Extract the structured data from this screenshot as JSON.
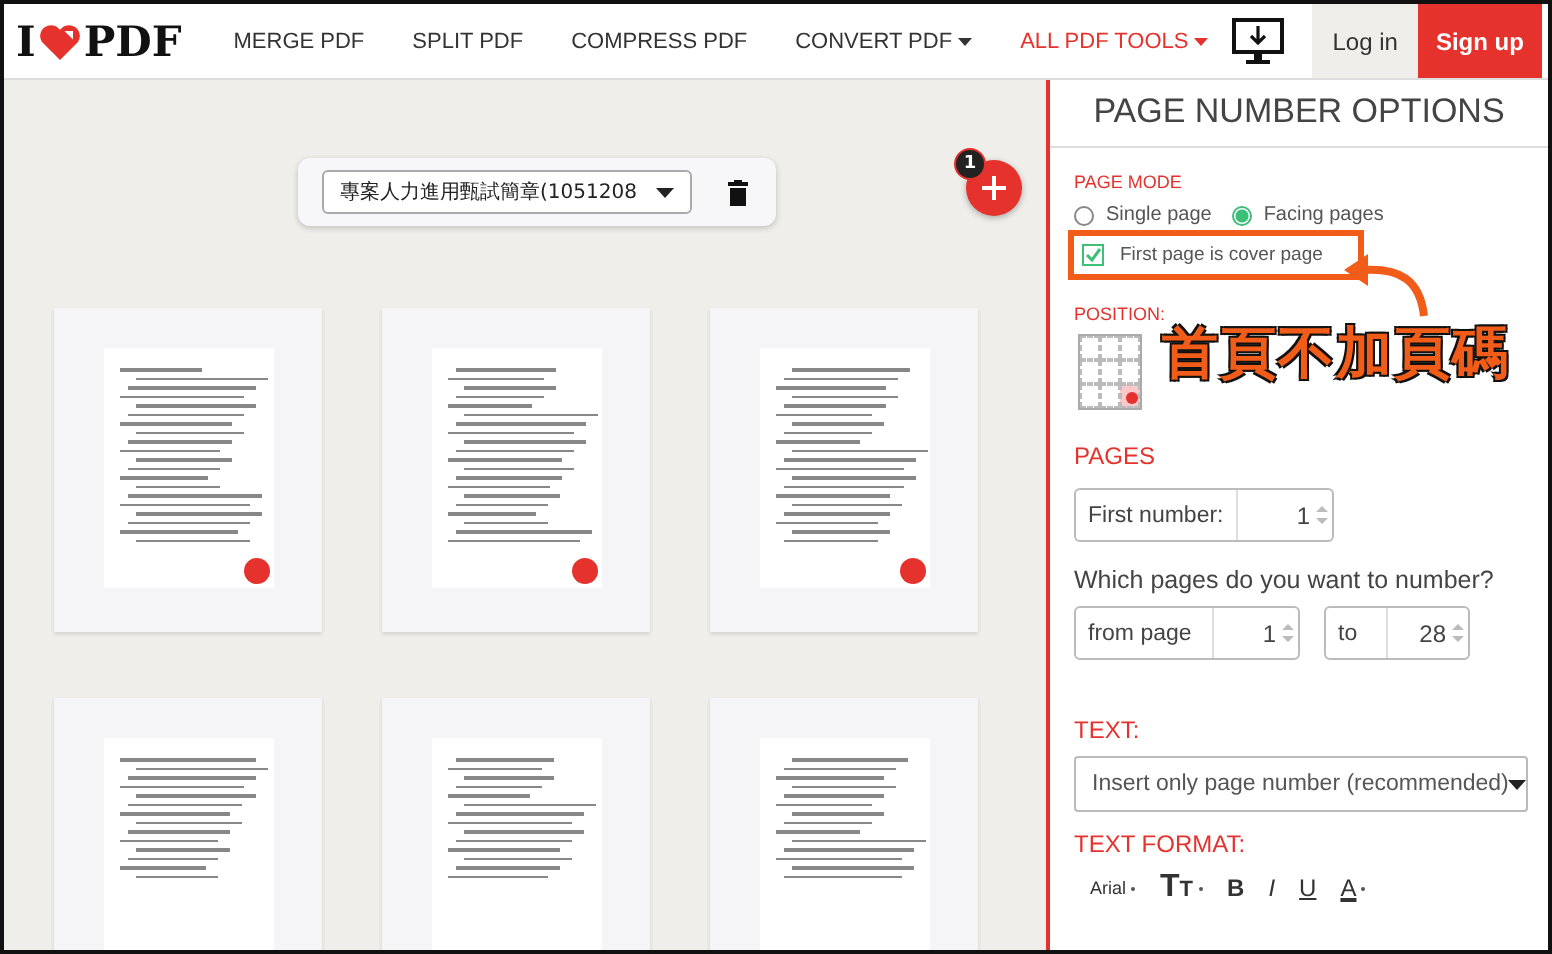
{
  "header": {
    "logo": {
      "left": "I",
      "right": "PDF"
    },
    "nav": [
      {
        "label": "MERGE PDF",
        "dropdown": false,
        "highlighted": false
      },
      {
        "label": "SPLIT PDF",
        "dropdown": false,
        "highlighted": false
      },
      {
        "label": "COMPRESS PDF",
        "dropdown": false,
        "highlighted": false
      },
      {
        "label": "CONVERT PDF",
        "dropdown": true,
        "highlighted": false
      },
      {
        "label": "ALL PDF TOOLS",
        "dropdown": true,
        "highlighted": true
      }
    ],
    "login": "Log in",
    "signup": "Sign up"
  },
  "workspace": {
    "file_select": "專案人力進用甄試簡章(1051208",
    "add_badge": "1",
    "pages": [
      {
        "marked": true
      },
      {
        "marked": true
      },
      {
        "marked": true
      },
      {
        "marked": false
      },
      {
        "marked": false
      },
      {
        "marked": false
      }
    ]
  },
  "options": {
    "title": "PAGE NUMBER OPTIONS",
    "page_mode": {
      "label": "PAGE MODE",
      "options": [
        {
          "label": "Single page",
          "selected": false
        },
        {
          "label": "Facing pages",
          "selected": true
        }
      ]
    },
    "cover_page": {
      "label": "First page is cover page",
      "checked": true
    },
    "position": {
      "label": "POSITION:",
      "cells": [
        {
          "selected": false
        },
        {
          "selected": false
        },
        {
          "selected": false
        },
        {
          "selected": false
        },
        {
          "selected": false
        },
        {
          "selected": false
        },
        {
          "selected": false
        },
        {
          "selected": false
        },
        {
          "selected": true
        }
      ]
    },
    "pages": {
      "label": "PAGES",
      "first_number": {
        "label": "First number:",
        "value": "1"
      },
      "question": "Which pages do you want to number?",
      "from": {
        "label": "from page",
        "value": "1"
      },
      "to": {
        "label": "to",
        "value": "28"
      }
    },
    "text": {
      "label": "TEXT:",
      "value": "Insert only page number (recommended)"
    },
    "text_format": {
      "label": "TEXT FORMAT:",
      "tools": [
        {
          "kind": "font",
          "label": "Arial"
        },
        {
          "kind": "size",
          "label": "TT"
        },
        {
          "kind": "bold",
          "label": "B"
        },
        {
          "kind": "italic",
          "label": "I"
        },
        {
          "kind": "underline",
          "label": "U"
        },
        {
          "kind": "color",
          "label": "A"
        }
      ]
    }
  },
  "callout": {
    "text": "首頁不加頁碼"
  }
}
